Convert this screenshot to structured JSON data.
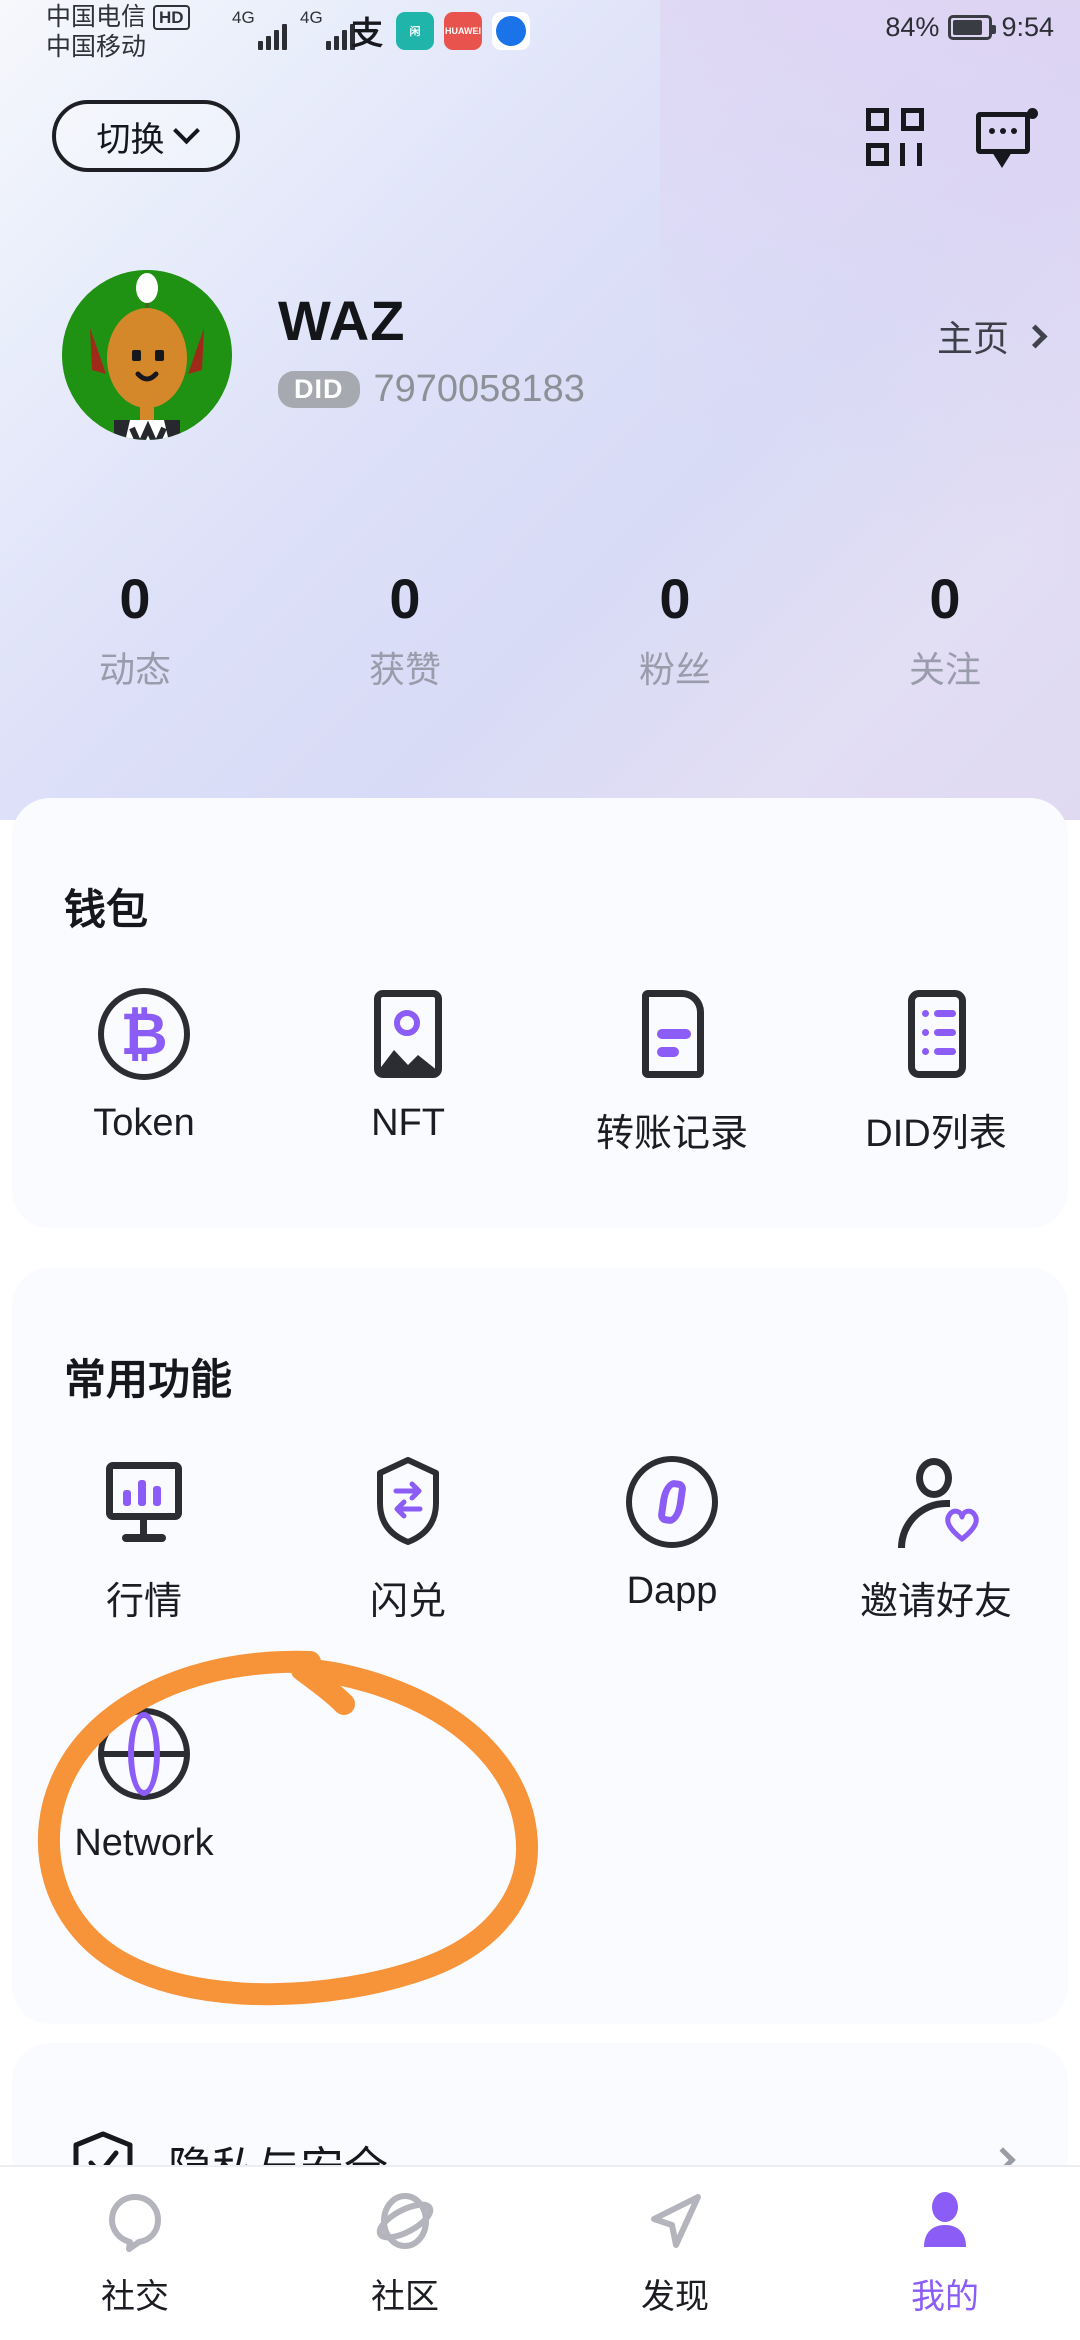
{
  "status_bar": {
    "carrier_primary": "中国电信",
    "carrier_primary_badge": "HD",
    "carrier_secondary": "中国移动",
    "network_1": "4G",
    "network_2": "4G",
    "battery_percent": "84%",
    "time": "9:54",
    "app_icons": [
      "alipay-icon",
      "xianyu-icon",
      "huawei-icon",
      "browser-icon"
    ]
  },
  "topbar": {
    "switch_label": "切换",
    "switch_icon": "chevron-down-icon",
    "qr_icon": "qr-scan-icon",
    "message_icon": "message-dots-icon"
  },
  "profile": {
    "avatar": "user-avatar",
    "username": "WAZ",
    "did_badge": "DID",
    "did_number": "7970058183",
    "home_link": "主页",
    "home_chevron": "chevron-right-icon"
  },
  "stats": [
    {
      "value": "0",
      "label": "动态"
    },
    {
      "value": "0",
      "label": "获赞"
    },
    {
      "value": "0",
      "label": "粉丝"
    },
    {
      "value": "0",
      "label": "关注"
    }
  ],
  "wallet": {
    "title": "钱包",
    "items": [
      {
        "label": "Token",
        "icon": "bitcoin-icon"
      },
      {
        "label": "NFT",
        "icon": "image-icon"
      },
      {
        "label": "转账记录",
        "icon": "document-icon"
      },
      {
        "label": "DID列表",
        "icon": "list-icon"
      }
    ]
  },
  "common_functions": {
    "title": "常用功能",
    "items": [
      {
        "label": "行情",
        "icon": "monitor-chart-icon"
      },
      {
        "label": "闪兑",
        "icon": "shield-swap-icon"
      },
      {
        "label": "Dapp",
        "icon": "dapp-circle-icon"
      },
      {
        "label": "邀请好友",
        "icon": "person-heart-icon"
      },
      {
        "label": "Network",
        "icon": "globe-icon"
      }
    ]
  },
  "privacy_row": {
    "label": "隐私与安全",
    "icon": "shield-check-icon",
    "chevron": "chevron-right-icon"
  },
  "annotation": {
    "type": "hand-drawn-circle",
    "color": "#F79339",
    "target": "Network"
  },
  "bottom_nav": [
    {
      "label": "社交",
      "icon": "chat-bubble-icon",
      "active": false
    },
    {
      "label": "社区",
      "icon": "planet-icon",
      "active": false
    },
    {
      "label": "发现",
      "icon": "paper-plane-icon",
      "active": false
    },
    {
      "label": "我的",
      "icon": "person-icon",
      "active": true
    }
  ],
  "colors": {
    "accent_purple": "#8b5cf6",
    "annotation_orange": "#F79339",
    "ink": "#16181d",
    "muted": "#9a9cab",
    "card_bg": "#fafbfe"
  }
}
